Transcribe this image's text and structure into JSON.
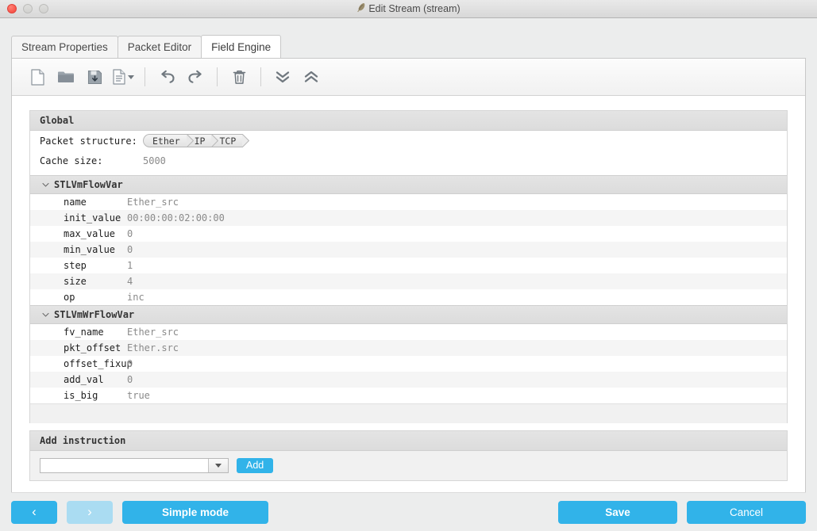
{
  "window": {
    "title": "Edit Stream (stream)",
    "title_icon": "feather-icon",
    "controls": {
      "close": "close-button",
      "minimize": "minimize-button",
      "maximize": "maximize-button"
    }
  },
  "tabs": [
    {
      "label": "Stream Properties",
      "active": false
    },
    {
      "label": "Packet Editor",
      "active": false
    },
    {
      "label": "Field Engine",
      "active": true
    }
  ],
  "toolbar": {
    "items": [
      {
        "icon": "new-document-icon",
        "name": "new-button"
      },
      {
        "icon": "open-folder-icon",
        "name": "open-button"
      },
      {
        "icon": "save-disk-icon",
        "name": "save-button"
      },
      {
        "icon": "template-document-icon",
        "name": "template-dropdown-button",
        "has_caret": true
      },
      {
        "icon": "undo-arrow-icon",
        "name": "undo-button"
      },
      {
        "icon": "redo-arrow-icon",
        "name": "redo-button"
      },
      {
        "icon": "trash-icon",
        "name": "delete-button"
      },
      {
        "icon": "double-chevron-down-icon",
        "name": "expand-all-button"
      },
      {
        "icon": "double-chevron-up-icon",
        "name": "collapse-all-button"
      }
    ]
  },
  "global": {
    "header": "Global",
    "packet_structure_label": "Packet structure:",
    "packet_structure": [
      "Ether",
      "IP",
      "TCP"
    ],
    "cache_size_label": "Cache size:",
    "cache_size_value": "5000"
  },
  "groups": [
    {
      "title": "STLVmFlowVar",
      "expanded": true,
      "rows": [
        {
          "key": "name",
          "value": "Ether_src"
        },
        {
          "key": "init_value",
          "value": "00:00:00:02:00:00"
        },
        {
          "key": "max_value",
          "value": "0"
        },
        {
          "key": "min_value",
          "value": "0"
        },
        {
          "key": "step",
          "value": "1"
        },
        {
          "key": "size",
          "value": "4"
        },
        {
          "key": "op",
          "value": "inc"
        }
      ]
    },
    {
      "title": "STLVmWrFlowVar",
      "expanded": true,
      "rows": [
        {
          "key": "fv_name",
          "value": "Ether_src"
        },
        {
          "key": "pkt_offset",
          "value": "Ether.src"
        },
        {
          "key": "offset_fixup",
          "value": "0"
        },
        {
          "key": "add_val",
          "value": "0"
        },
        {
          "key": "is_big",
          "value": "true"
        }
      ]
    }
  ],
  "add_instruction": {
    "header": "Add instruction",
    "combo_value": "",
    "combo_placeholder": "",
    "add_label": "Add"
  },
  "bottom_bar": {
    "back_label": "‹",
    "forward_label": "›",
    "forward_disabled": true,
    "simple_mode_label": "Simple mode",
    "save_label": "Save",
    "cancel_label": "Cancel"
  },
  "colors": {
    "accent": "#31b3e9",
    "accent_disabled": "#aadcf2",
    "window_bg": "#eceded",
    "panel_bg": "#ffffff",
    "row_alt": "#f5f5f5",
    "section_header": "#dedede",
    "value_text": "#8a8a8a"
  }
}
